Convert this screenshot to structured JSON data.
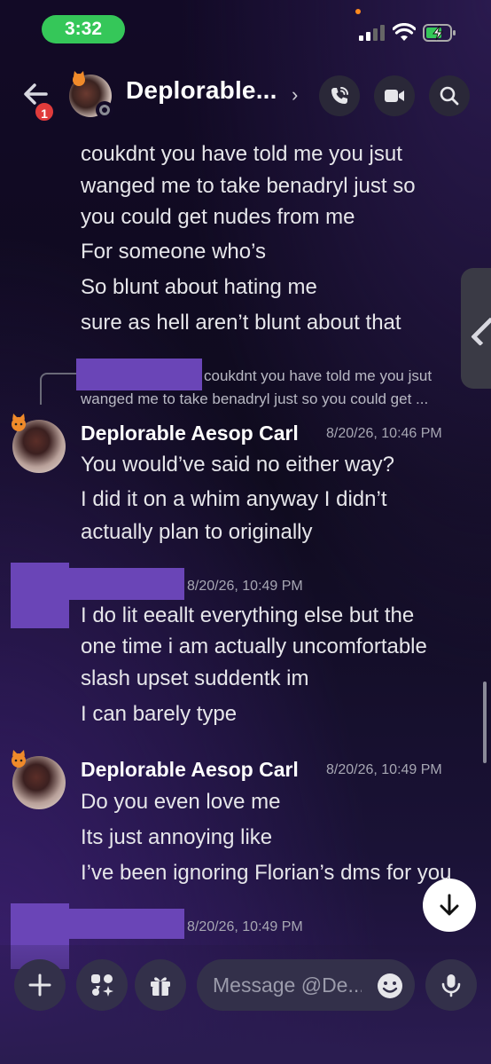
{
  "status_bar": {
    "time": "3:32"
  },
  "header": {
    "back_badge": "1",
    "channel_name": "Deplorable...",
    "chevron": "›"
  },
  "messages": {
    "m1_lines": [
      "coukdnt you have told me you jsut",
      "wanged me to take benadryl just so",
      "you could get nudes from me",
      "For someone who’s",
      "So blunt about hating me",
      "sure as hell aren’t blunt about that"
    ],
    "reply_preview_line1": "coukdnt you have told me you jsut",
    "reply_preview_line2": "wanged me to take benadryl just so you could get ...",
    "m2_author": "Deplorable Aesop Carl",
    "m2_time": "8/20/26, 10:46 PM",
    "m2_lines": [
      "You would’ve said no either way?",
      "I did it on a whim anyway I didn’t",
      "actually plan to originally"
    ],
    "m3_time": "8/20/26, 10:49 PM",
    "m3_lines": [
      "I do lit eeallt everything else but the",
      "one time i am actually uncomfortable",
      "slash upset suddentk im",
      "I can barely type"
    ],
    "m4_author": "Deplorable Aesop Carl",
    "m4_time": "8/20/26, 10:49 PM",
    "m4_lines": [
      "Do you even love me",
      "Its just annoying like",
      "I’ve been ignoring Florian’s dms for you"
    ],
    "m5_time": "8/20/26, 10:49 PM"
  },
  "composer": {
    "placeholder": "Message @De..."
  },
  "colors": {
    "accent_green": "#35c759",
    "redaction": "#6a45b7",
    "badge_red": "#e03b3b"
  },
  "icons": [
    "back-arrow-icon",
    "phone-call-icon",
    "video-camera-icon",
    "search-icon",
    "arrow-down-icon",
    "plus-icon",
    "apps-icon",
    "gift-icon",
    "emoji-icon",
    "microphone-icon"
  ]
}
